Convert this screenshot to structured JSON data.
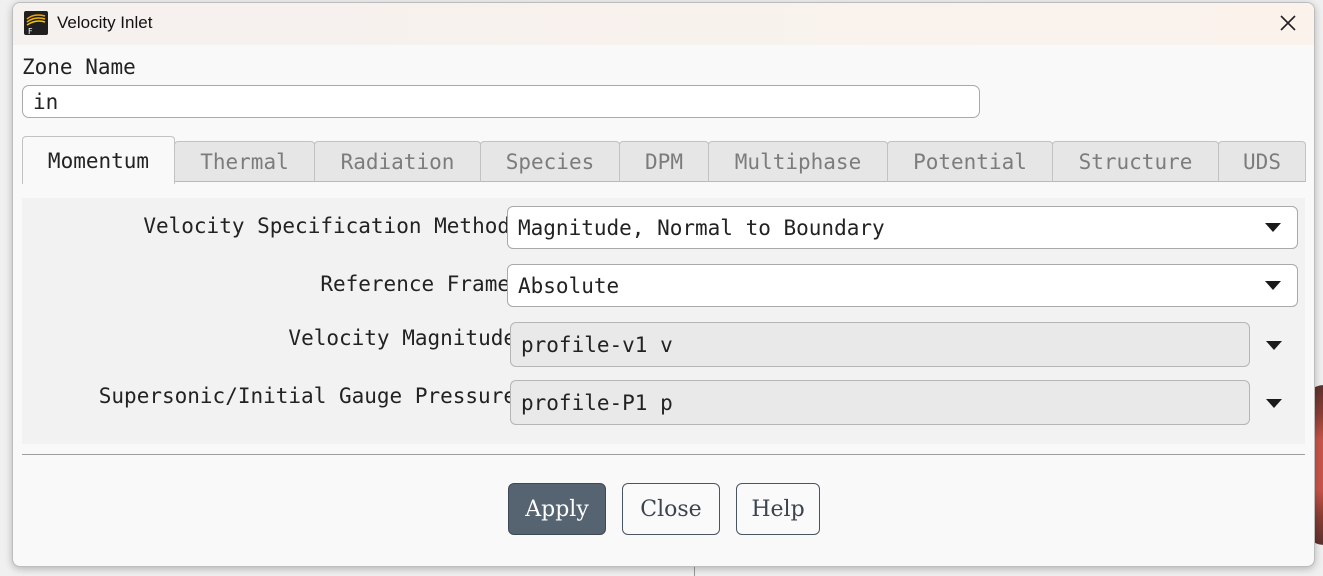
{
  "window": {
    "title": "Velocity Inlet"
  },
  "zone": {
    "label": "Zone Name",
    "value": "in"
  },
  "tabs": [
    {
      "label": "Momentum",
      "active": true
    },
    {
      "label": "Thermal",
      "active": false
    },
    {
      "label": "Radiation",
      "active": false
    },
    {
      "label": "Species",
      "active": false
    },
    {
      "label": "DPM",
      "active": false
    },
    {
      "label": "Multiphase",
      "active": false
    },
    {
      "label": "Potential",
      "active": false
    },
    {
      "label": "Structure",
      "active": false
    },
    {
      "label": "UDS",
      "active": false
    }
  ],
  "momentum": {
    "velocity_spec_label": "Velocity Specification Method",
    "velocity_spec_value": "Magnitude, Normal to Boundary",
    "reference_frame_label": "Reference Frame",
    "reference_frame_value": "Absolute",
    "velocity_magnitude_label": "Velocity Magnitude",
    "velocity_magnitude_value": "profile-v1 v",
    "gauge_pressure_label": "Supersonic/Initial Gauge Pressure",
    "gauge_pressure_value": "profile-P1 p"
  },
  "buttons": {
    "apply": "Apply",
    "close": "Close",
    "help": "Help"
  },
  "icons": {
    "app": "fluent-app-icon",
    "close": "close-icon",
    "dropdown": "chevron-down-icon"
  },
  "colors": {
    "primary_button": "#566371",
    "titlebar": "#fbf2ec"
  }
}
